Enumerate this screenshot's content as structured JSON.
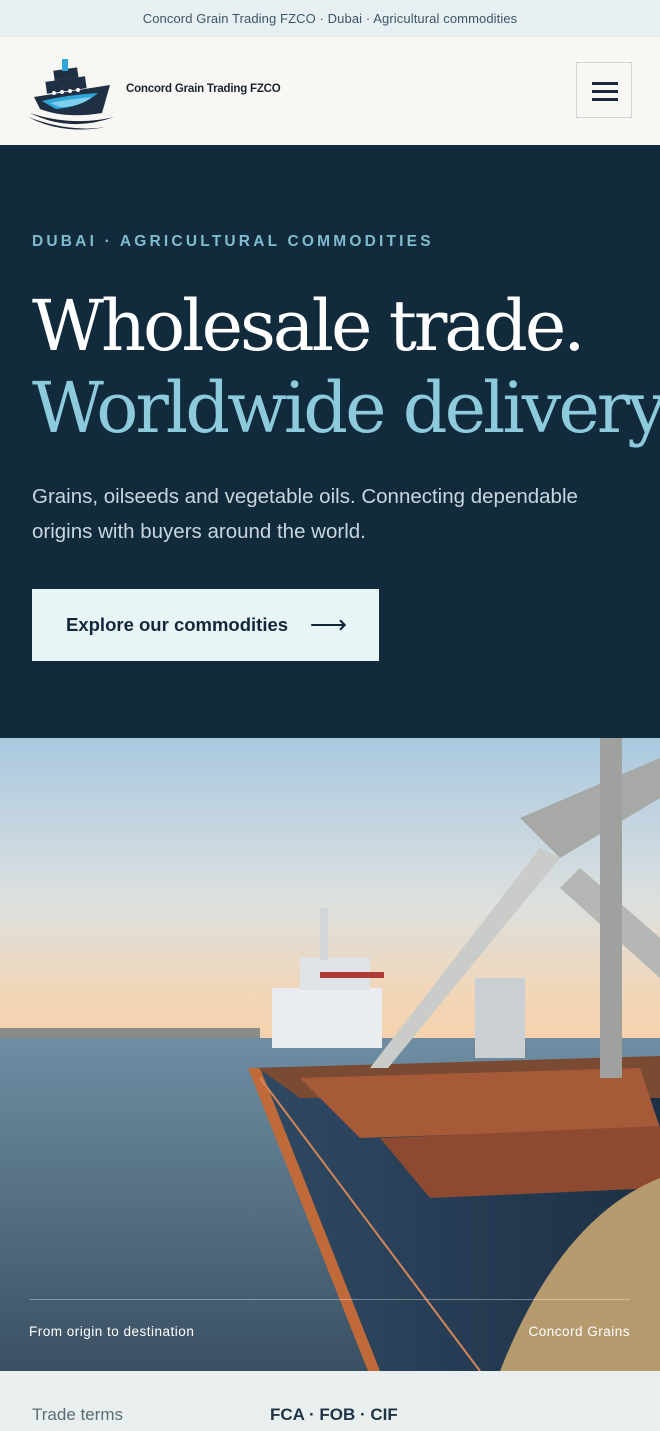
{
  "topbar": {
    "text": "Concord Grain Trading FZCO · Dubai · Agricultural commodities"
  },
  "header": {
    "brand": "Concord Grain Trading FZCO",
    "menu_icon": "hamburger-menu-icon",
    "logo_icon": "ship-logo-icon"
  },
  "hero": {
    "kicker": "DUBAI · AGRICULTURAL COMMODITIES",
    "title_line1": "Wholesale trade.",
    "title_line2": "Worldwide delivery.",
    "lede": "Grains, oilseeds and vegetable oils. Connecting dependable origins with buyers around the world.",
    "cta_label": "Explore our commodities",
    "cta_icon": "arrow-right-icon"
  },
  "photo": {
    "caption_left": "From origin to destination",
    "caption_right": "Concord Grains"
  },
  "terms": {
    "label": "Trade terms",
    "value": "FCA · FOB · CIF"
  },
  "colors": {
    "hero_bg": "#112a3c",
    "accent": "#8ccadc",
    "topbar_bg": "#e7eff2",
    "cta_bg": "#e9f4f6"
  }
}
